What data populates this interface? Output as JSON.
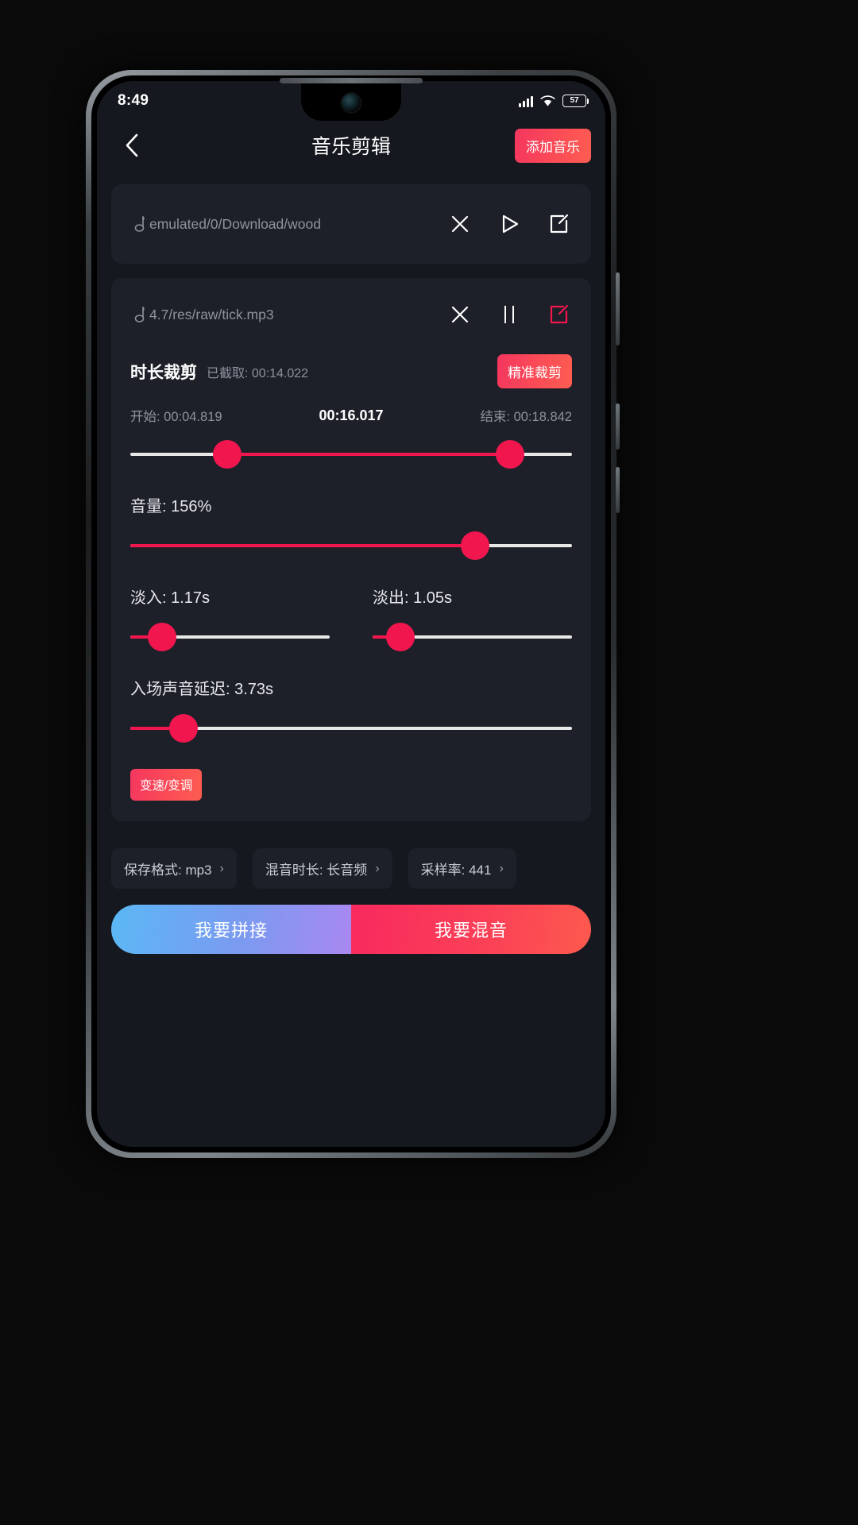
{
  "status_bar": {
    "time": "8:49",
    "battery_level": "57",
    "signal_icon": "signal-bars-icon",
    "wifi_icon": "wifi-icon",
    "battery_icon": "battery-icon"
  },
  "header": {
    "back_icon": "chevron-left-icon",
    "title": "音乐剪辑",
    "add_music_label": "添加音乐"
  },
  "tracks": [
    {
      "note_icon": "music-note-icon",
      "path": "emulated/0/Download/wood",
      "close_icon": "close-icon",
      "play_icon": "play-icon",
      "edit_icon": "edit-icon",
      "playing": false
    },
    {
      "note_icon": "music-note-icon",
      "path": "4.7/res/raw/tick.mp3",
      "close_icon": "close-icon",
      "pause_icon": "pause-icon",
      "edit_icon": "edit-icon",
      "playing": true
    }
  ],
  "trim": {
    "title": "时长裁剪",
    "captured_label": "已截取: 00:14.022",
    "precise_button": "精准裁剪",
    "start_label": "开始: 00:04.819",
    "current_label": "00:16.017",
    "end_label": "结束: 00:18.842",
    "range_start_pct": 22,
    "range_end_pct": 86
  },
  "volume": {
    "label": "音量: 156%",
    "value_pct": 78
  },
  "fade_in": {
    "label": "淡入: 1.17s",
    "value_pct": 16
  },
  "fade_out": {
    "label": "淡出: 1.05s",
    "value_pct": 14
  },
  "delay": {
    "label": "入场声音延迟: 3.73s",
    "value_pct": 12
  },
  "speed_button": "变速/变调",
  "chips": [
    {
      "label": "保存格式: mp3",
      "chevron": "›"
    },
    {
      "label": "混音时长: 长音频",
      "chevron": "›"
    },
    {
      "label": "采样率: 441",
      "chevron": "›"
    }
  ],
  "bottom_actions": {
    "join_label": "我要拼接",
    "mix_label": "我要混音"
  },
  "colors": {
    "accent": "#f2164f",
    "card_bg": "#1d2029",
    "screen_bg": "#16181f",
    "muted_text": "#8d929d"
  }
}
